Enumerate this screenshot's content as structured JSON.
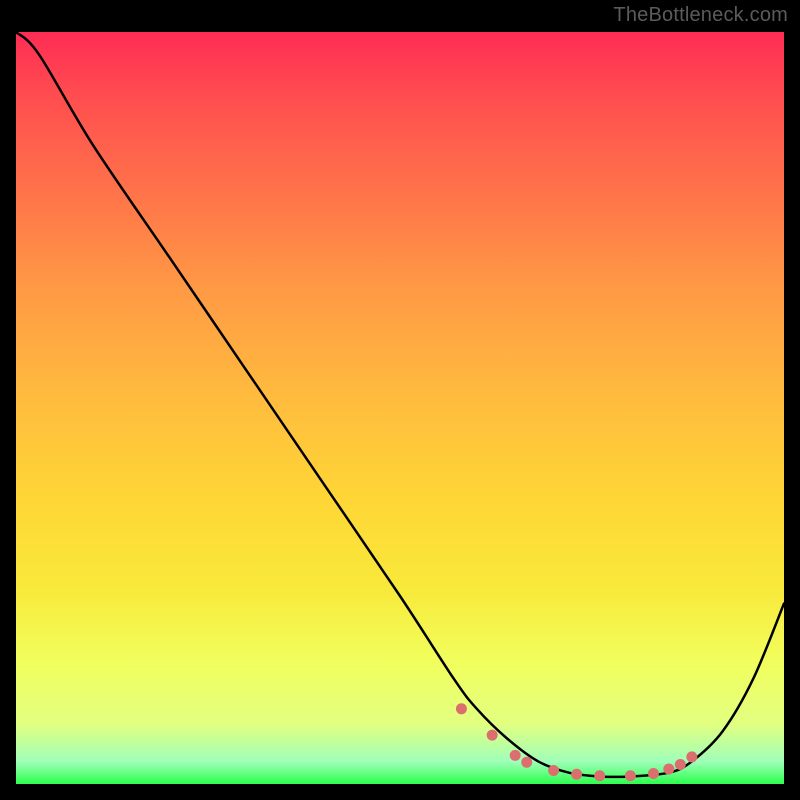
{
  "watermark": "TheBottleneck.com",
  "chart_data": {
    "type": "line",
    "title": "",
    "xlabel": "",
    "ylabel": "",
    "xlim": [
      0,
      100
    ],
    "ylim": [
      0,
      100
    ],
    "grid": false,
    "legend": false,
    "series": [
      {
        "name": "curve",
        "color": "#000000",
        "x": [
          0,
          3,
          10,
          20,
          30,
          40,
          50,
          57,
          60,
          64,
          68,
          72,
          76,
          80,
          85,
          88,
          92,
          96,
          100
        ],
        "y": [
          100,
          97,
          85,
          70,
          55,
          40,
          25,
          14,
          10,
          6,
          3,
          1.5,
          1,
          1,
          1.5,
          3,
          7,
          14,
          24
        ]
      }
    ],
    "markers": {
      "name": "dots",
      "color": "#dc6e6f",
      "x": [
        58,
        62,
        65,
        66.5,
        70,
        73,
        76,
        80,
        83,
        85,
        86.5,
        88
      ],
      "y": [
        10,
        6.5,
        3.8,
        2.9,
        1.8,
        1.3,
        1.1,
        1.1,
        1.4,
        2.0,
        2.6,
        3.6
      ]
    },
    "background_gradient": {
      "top": "#ff2c55",
      "upper_mid": "#ff9945",
      "mid": "#ffd636",
      "lower_mid": "#f1ff5e",
      "bottom": "#2dff4e"
    }
  }
}
